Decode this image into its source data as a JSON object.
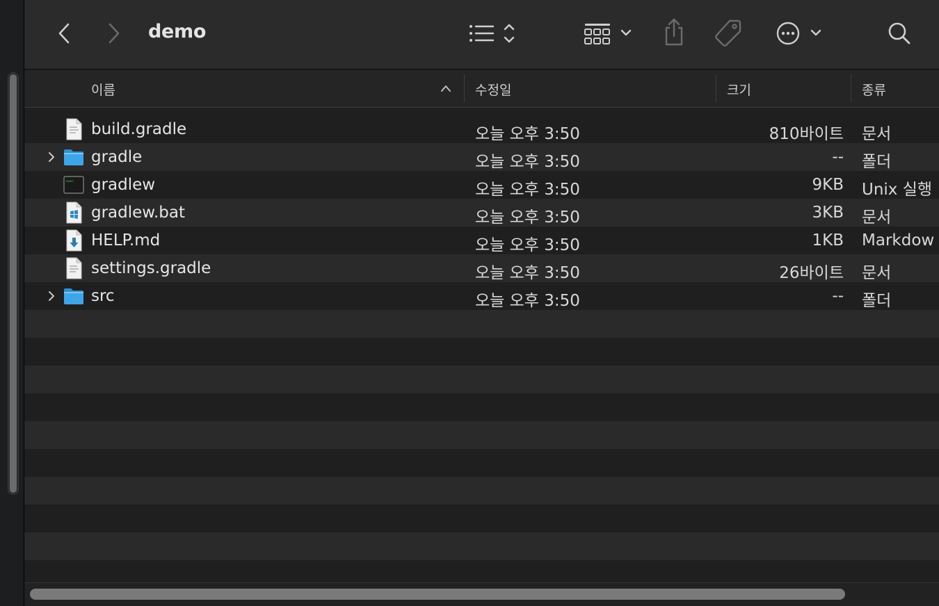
{
  "window": {
    "title": "demo"
  },
  "toolbar": {
    "back_icon": "chevron-left-icon",
    "forward_icon": "chevron-right-icon",
    "view_icon": "list-view-icon",
    "group_icon": "group-grid-icon",
    "share_icon": "share-icon",
    "tag_icon": "tag-icon",
    "more_icon": "ellipsis-circle-icon",
    "search_icon": "search-icon"
  },
  "columns": {
    "name": "이름",
    "date": "수정일",
    "size": "크기",
    "kind": "종류"
  },
  "files": [
    {
      "name": "build.gradle",
      "date": "오늘 오후 3:50",
      "size": "810바이트",
      "kind": "문서",
      "icon": "document-icon",
      "expandable": false
    },
    {
      "name": "gradle",
      "date": "오늘 오후 3:50",
      "size": "--",
      "kind": "폴더",
      "icon": "folder-icon",
      "expandable": true
    },
    {
      "name": "gradlew",
      "date": "오늘 오후 3:50",
      "size": "9KB",
      "kind": "Unix 실행",
      "icon": "terminal-exec-icon",
      "expandable": false
    },
    {
      "name": "gradlew.bat",
      "date": "오늘 오후 3:50",
      "size": "3KB",
      "kind": "문서",
      "icon": "windows-doc-icon",
      "expandable": false
    },
    {
      "name": "HELP.md",
      "date": "오늘 오후 3:50",
      "size": "1KB",
      "kind": "Markdow",
      "icon": "markdown-doc-icon",
      "expandable": false
    },
    {
      "name": "settings.gradle",
      "date": "오늘 오후 3:50",
      "size": "26바이트",
      "kind": "문서",
      "icon": "document-icon",
      "expandable": false
    },
    {
      "name": "src",
      "date": "오늘 오후 3:50",
      "size": "--",
      "kind": "폴더",
      "icon": "folder-icon",
      "expandable": true
    }
  ],
  "colors": {
    "folder": "#3ea6e8",
    "accent_text": "#e6e6e6"
  }
}
